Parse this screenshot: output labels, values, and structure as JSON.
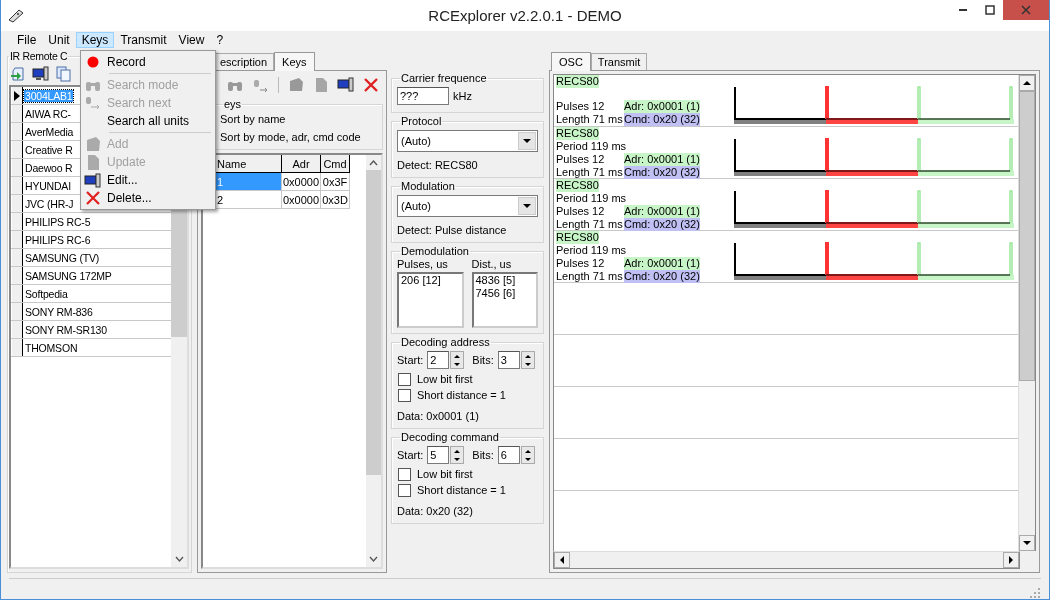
{
  "window": {
    "title": "RCExplorer v2.2.0.1 - DEMO"
  },
  "menu": [
    {
      "label": "File",
      "selected": false
    },
    {
      "label": "Unit",
      "selected": false
    },
    {
      "label": "Keys",
      "selected": true
    },
    {
      "label": "Transmit",
      "selected": false
    },
    {
      "label": "View",
      "selected": false
    },
    {
      "label": "?",
      "selected": false
    }
  ],
  "keys_menu": [
    {
      "kind": "item",
      "label": "Record",
      "disabled": false
    },
    {
      "kind": "separator"
    },
    {
      "kind": "item",
      "label": "Search mode",
      "disabled": true
    },
    {
      "kind": "item",
      "label": "Search next",
      "disabled": true
    },
    {
      "kind": "item",
      "label": "Search all units",
      "disabled": false
    },
    {
      "kind": "separator"
    },
    {
      "kind": "item",
      "label": "Add",
      "disabled": true
    },
    {
      "kind": "item",
      "label": "Update",
      "disabled": true
    },
    {
      "kind": "item",
      "label": "Edit...",
      "disabled": false
    },
    {
      "kind": "item",
      "label": "Delete...",
      "disabled": false
    }
  ],
  "units_panel": {
    "title": "IR Remote C",
    "units": [
      {
        "name": "3004LAB1",
        "selected": true
      },
      {
        "name": "AIWA RC-",
        "selected": false
      },
      {
        "name": "AverMedia",
        "selected": false
      },
      {
        "name": "Creative R",
        "selected": false
      },
      {
        "name": "Daewoo R",
        "selected": false
      },
      {
        "name": "HYUNDAI",
        "selected": false
      },
      {
        "name": "JVC (HR-J",
        "selected": false
      },
      {
        "name": "PHILIPS RC-5",
        "selected": false
      },
      {
        "name": "PHILIPS RC-6",
        "selected": false
      },
      {
        "name": "SAMSUNG (TV)",
        "selected": false
      },
      {
        "name": "SAMSUNG 172MP",
        "selected": false
      },
      {
        "name": "Softpedia",
        "selected": false
      },
      {
        "name": "SONY RM-836",
        "selected": false
      },
      {
        "name": "SONY RM-SR130",
        "selected": false
      },
      {
        "name": "THOMSON",
        "selected": false
      }
    ]
  },
  "unit_tabs": [
    {
      "label": "escription",
      "selected": false
    },
    {
      "label": "Keys",
      "selected": true
    }
  ],
  "keys_group": {
    "title": "eys",
    "sort_options": [
      "Sort by name",
      "Sort by mode, adr, cmd code"
    ]
  },
  "keys_table": {
    "columns": [
      "Name",
      "Adr",
      "Cmd"
    ],
    "rows": [
      {
        "cells": [
          "1",
          "0x0000",
          "0x3F"
        ],
        "selected": true
      },
      {
        "cells": [
          "2",
          "0x0000",
          "0x3D"
        ],
        "selected": false
      }
    ]
  },
  "carrier": {
    "title": "Carrier frequence",
    "value": "???",
    "unit": "kHz"
  },
  "protocol": {
    "title": "Protocol",
    "value": "(Auto)",
    "detect": "Detect: RECS80"
  },
  "modulation": {
    "title": "Modulation",
    "value": "(Auto)",
    "detect": "Detect: Pulse distance"
  },
  "demodulation": {
    "title": "Demodulation",
    "pulses_label": "Pulses, us",
    "pulses": [
      "206 [12]"
    ],
    "dist_label": "Dist., us",
    "dist": [
      "4836 [5]",
      "7456 [6]"
    ]
  },
  "decoding": [
    {
      "title": "Decoding address",
      "start_label": "Start:",
      "start": "2",
      "bits_label": "Bits:",
      "bits": "3",
      "options": [
        {
          "label": "Low bit first",
          "checked": false
        },
        {
          "label": "Short distance = 1",
          "checked": false
        }
      ],
      "data": "Data: 0x0001 (1)"
    },
    {
      "title": "Decoding command",
      "start_label": "Start:",
      "start": "5",
      "bits_label": "Bits:",
      "bits": "6",
      "options": [
        {
          "label": "Low bit first",
          "checked": false
        },
        {
          "label": "Short distance = 1",
          "checked": false
        }
      ],
      "data": "Data: 0x20 (32)"
    }
  ],
  "osc_tabs": [
    {
      "label": "OSC",
      "selected": true
    },
    {
      "label": "Transmit",
      "selected": false
    }
  ],
  "signals": [
    {
      "protocol": "RECS80",
      "pulses": "Pulses 12",
      "length": "Length 71 ms",
      "adr": "Adr: 0x0001 (1)",
      "cmd": "Cmd: 0x20 (32)"
    },
    {
      "protocol": "RECS80",
      "period": "Period 119 ms",
      "pulses": "Pulses 12",
      "length": "Length 71 ms",
      "adr": "Adr: 0x0001 (1)",
      "cmd": "Cmd: 0x20 (32)"
    },
    {
      "protocol": "RECS80",
      "period": "Period 119 ms",
      "pulses": "Pulses 12",
      "length": "Length 71 ms",
      "adr": "Adr: 0x0001 (1)",
      "cmd": "Cmd: 0x20 (32)"
    },
    {
      "protocol": "RECS80",
      "period": "Period 119 ms",
      "pulses": "Pulses 12",
      "length": "Length 71 ms",
      "adr": "Adr: 0x0001 (1)",
      "cmd": "Cmd: 0x20 (32)"
    }
  ]
}
